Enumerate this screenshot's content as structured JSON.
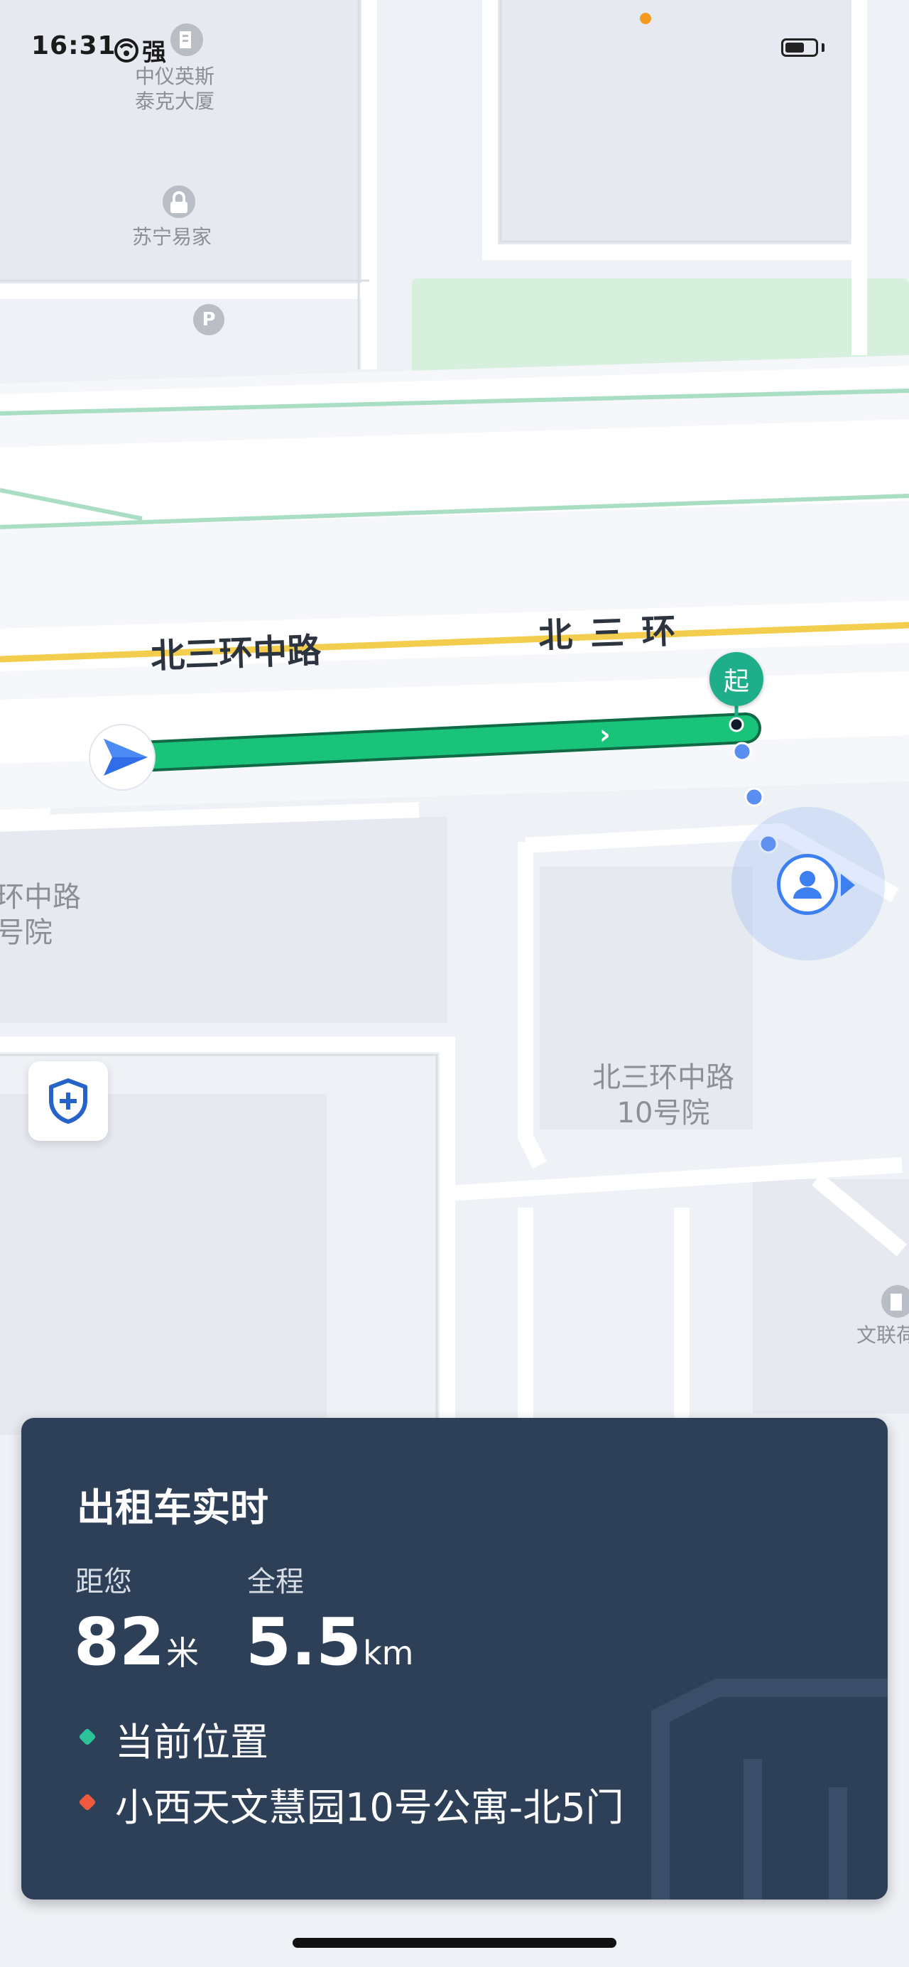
{
  "status_bar": {
    "time": "16:31",
    "signal_text": "强"
  },
  "map": {
    "road_labels": [
      "北三环中路",
      "北 三 环"
    ],
    "pois": {
      "top": "中仪英斯\n泰克大厦",
      "suning": "苏宁易家",
      "parking_icon": "P",
      "left_block": "环中路\n号院",
      "block_10": "北三环中路\n10号院",
      "right_edge": "文联荷"
    },
    "start_badge": "起",
    "colors": {
      "route": "#19c37a",
      "road_yellow": "#f3cd4d",
      "road_green": "#a9dec3",
      "user_blue": "#3c7ff0",
      "start_badge": "#1fae8a"
    },
    "icons": [
      "navigation-arrow-icon",
      "shield-plus-icon",
      "user-location-icon",
      "lock-icon",
      "parking-icon",
      "building-icon"
    ]
  },
  "card": {
    "title": "出租车实时",
    "distance_label": "距您",
    "distance_value": "82",
    "distance_unit": "米",
    "total_label": "全程",
    "total_value": "5.5",
    "total_unit": "km",
    "current_location": "当前位置",
    "destination": "小西天文慧园10号公寓-北5门",
    "colors": {
      "current_dot": "#2dc39a",
      "destination_dot": "#ef5a3c",
      "card_bg": "#2e3f58"
    }
  }
}
